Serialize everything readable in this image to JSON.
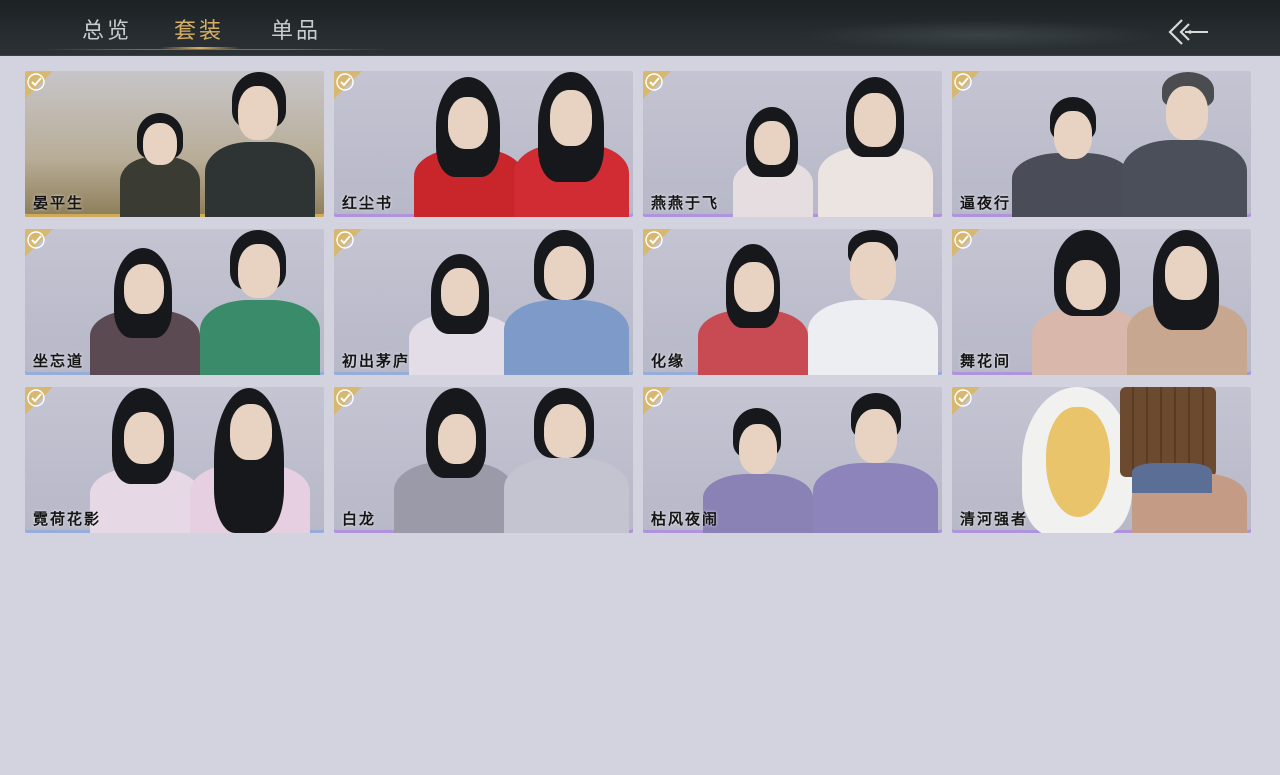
{
  "header": {
    "tabs": [
      {
        "label": "总览",
        "active": false
      },
      {
        "label": "套装",
        "active": true
      },
      {
        "label": "单品",
        "active": false
      }
    ],
    "back_icon": "double-chevron-left-arrow-icon"
  },
  "colors": {
    "active_tab": "#d8b063",
    "inactive_tab": "#c9ccce",
    "page_bg": "#d3d3df",
    "check_badge": "#d9b766"
  },
  "outfits": [
    {
      "name": "晏平生",
      "owned": true,
      "rarity": "gold"
    },
    {
      "name": "红尘书",
      "owned": true,
      "rarity": "purple"
    },
    {
      "name": "燕燕于飞",
      "owned": true,
      "rarity": "purple"
    },
    {
      "name": "逼夜行",
      "owned": true,
      "rarity": "purple"
    },
    {
      "name": "坐忘道",
      "owned": true,
      "rarity": "blue"
    },
    {
      "name": "初出茅庐",
      "owned": true,
      "rarity": "blue"
    },
    {
      "name": "化缘",
      "owned": true,
      "rarity": "blue"
    },
    {
      "name": "舞花间",
      "owned": true,
      "rarity": "purple"
    },
    {
      "name": "霓荷花影",
      "owned": true,
      "rarity": "blue"
    },
    {
      "name": "白龙",
      "owned": true,
      "rarity": "purple"
    },
    {
      "name": "枯风夜闹",
      "owned": true,
      "rarity": "purple"
    },
    {
      "name": "清河强者",
      "owned": true,
      "rarity": "purple"
    }
  ]
}
